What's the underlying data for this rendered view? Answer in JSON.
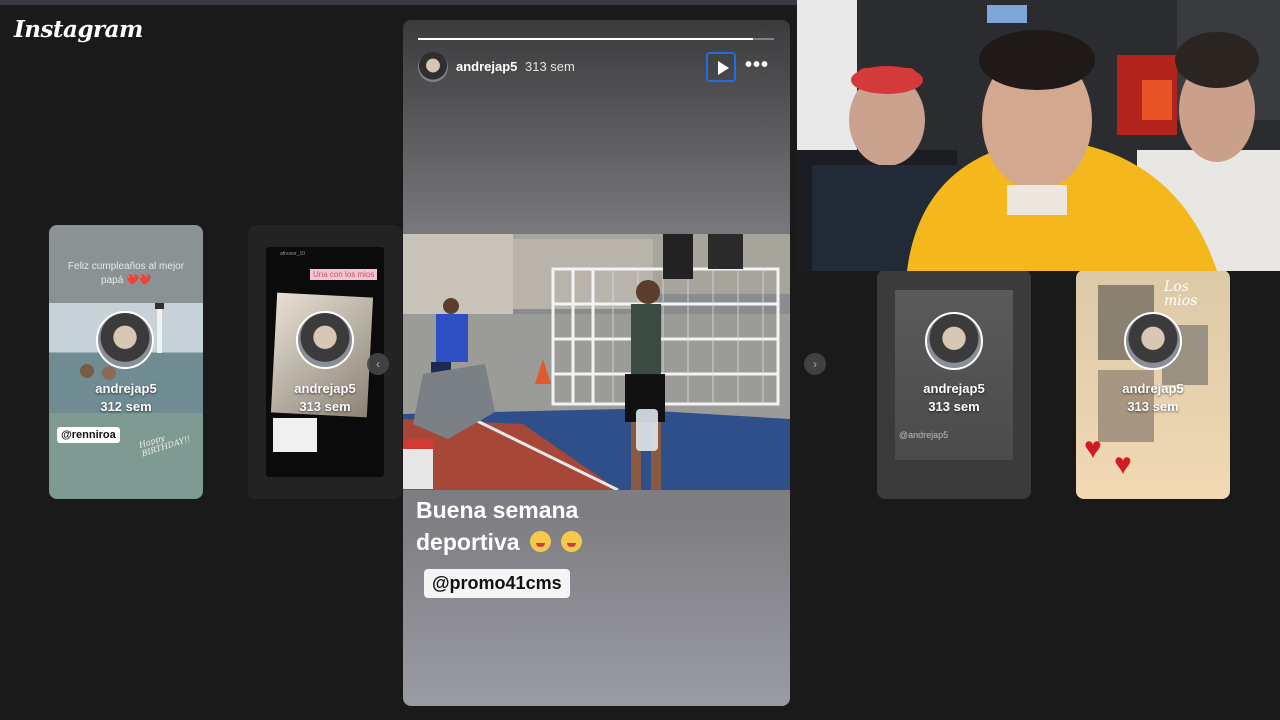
{
  "app": {
    "logo": "Instagram"
  },
  "stories_left": [
    {
      "username": "andrejap5",
      "time": "312 sem",
      "caption": "Feliz cumpleaños al mejor papá ❤️❤️",
      "mention": "@renniroa",
      "sticker": "Happy BIRTHDAY!!"
    },
    {
      "username": "andrejap5",
      "time": "313 sem",
      "label": "Una con los mios",
      "header_user": "afnosor_10"
    }
  ],
  "stories_right": [
    {
      "username": "andrejap5",
      "time": "313 sem",
      "mention": "@andrejap5"
    },
    {
      "username": "andrejap5",
      "time": "313 sem",
      "caption": "Los mios"
    }
  ],
  "current_story": {
    "username": "andrejap5",
    "time": "313 sem",
    "progress": 0.94,
    "headline_line1": "Buena semana",
    "headline_line2": "deportiva",
    "mention": "@promo41cms"
  },
  "colors": {
    "focus_outline": "#1e6fe0",
    "heart": "#d31a23",
    "hoodie": "#f5b81c"
  },
  "icons": [
    "play-icon",
    "more-options-icon",
    "prev-arrow-icon",
    "next-arrow-icon",
    "heart-icon"
  ]
}
